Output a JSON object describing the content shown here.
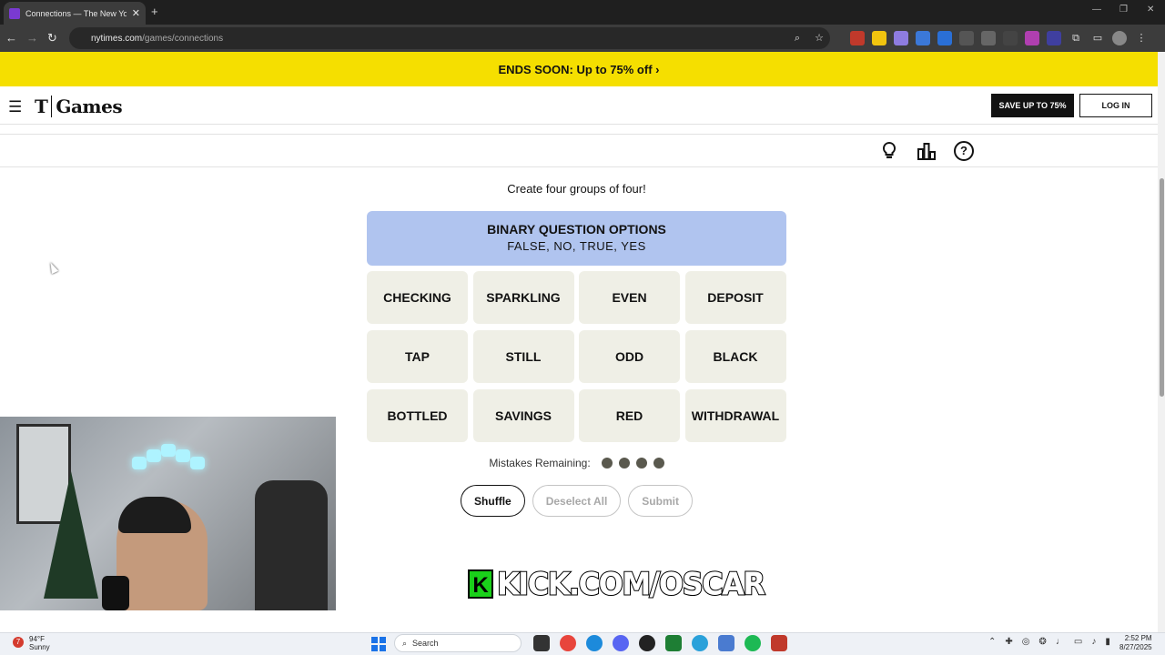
{
  "browser": {
    "tab_title": "Connections — The New York T",
    "tab_close": "✕",
    "new_tab": "+",
    "url_host": "nytimes.com",
    "url_path": "/games/connections"
  },
  "promo": {
    "text": "ENDS SOON:  Up to 75% off ›"
  },
  "header": {
    "logo_t": "T",
    "logo_text": "Games",
    "save_label": "SAVE UP TO 75%",
    "login_label": "LOG IN"
  },
  "game": {
    "instructions": "Create four groups of four!",
    "solved": {
      "title": "BINARY QUESTION OPTIONS",
      "words": "FALSE, NO, TRUE, YES",
      "color": "#b0c4ef"
    },
    "tiles": [
      "CHECKING",
      "SPARKLING",
      "EVEN",
      "DEPOSIT",
      "TAP",
      "STILL",
      "ODD",
      "BLACK",
      "BOTTLED",
      "SAVINGS",
      "RED",
      "WITHDRAWAL"
    ],
    "mistakes_label": "Mistakes Remaining:",
    "mistakes_remaining": 4,
    "shuffle_label": "Shuffle",
    "deselect_label": "Deselect All",
    "submit_label": "Submit"
  },
  "overlay": {
    "kick_logo": "K",
    "kick_text": "KICK.COM/OSCAR"
  },
  "taskbar": {
    "weather_badge": "7",
    "temperature": "94°F",
    "condition": "Sunny",
    "search_label": "Search",
    "time": "2:52 PM",
    "date": "8/27/2025"
  }
}
